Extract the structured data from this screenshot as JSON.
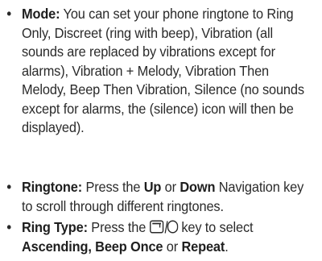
{
  "bullet_char": "•",
  "items": [
    {
      "term": "Mode:",
      "text": " You can set your phone ringtone to Ring Only, Discreet (ring with beep), Vibration (all sounds are replaced by vibrations except for alarms), Vibration + Melody, Vibration Then Melody, Beep Then Vibration, Silence (no sounds except for alarms, the (silence) icon will then be displayed)."
    },
    {
      "term": "Ringtone:",
      "t1": " Press the ",
      "k1": "Up",
      "t2": " or ",
      "k2": "Down",
      "t3": " Navigation key to scroll through different ringtones."
    },
    {
      "term": "Ring Type:",
      "t1": " Press the ",
      "icons": [
        "softkey-icon",
        "ok-key-icon"
      ],
      "t2": " key to select ",
      "o1": "Ascending, Beep Once",
      "t3": " or ",
      "o2": "Repeat",
      "t4": "."
    }
  ]
}
